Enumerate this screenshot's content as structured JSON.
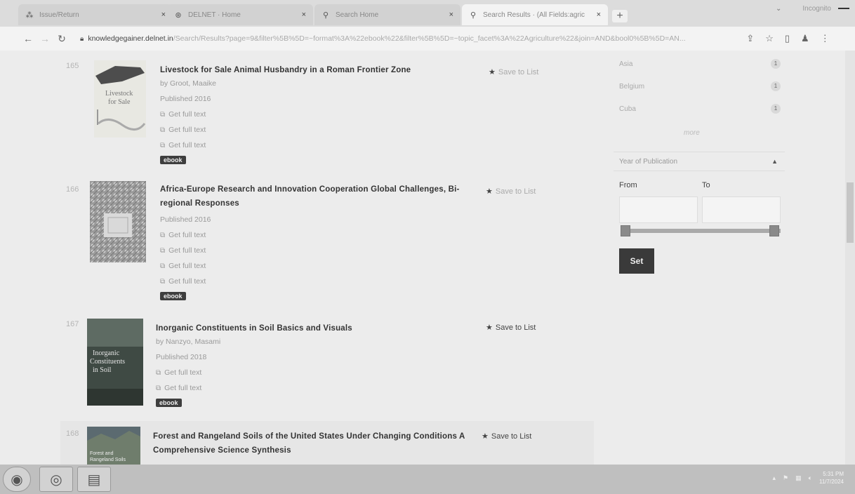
{
  "tabs": [
    {
      "title": "Issue/Return",
      "icon": "network-icon"
    },
    {
      "title": "DELNET · Home",
      "icon": "globe-icon"
    },
    {
      "title": "Search Home",
      "icon": "search-icon"
    },
    {
      "title": "Search Results · (All Fields:agric",
      "icon": "search-icon"
    }
  ],
  "window": {
    "profile_label": "Incognito",
    "profile_badge": ""
  },
  "address": {
    "domain": "knowledgegainer.delnet.in",
    "path": "/Search/Results?page=9&filter%5B%5D=~format%3A%22ebook%22&filter%5B%5D=~topic_facet%3A%22Agriculture%22&join=AND&bool0%5B%5D=AN..."
  },
  "results": [
    {
      "number": "165",
      "title_lines": [
        "Livestock for Sale Animal Husbandry in a Roman Frontier Zone"
      ],
      "author": "by Groot, Maaike",
      "published": "Published 2016",
      "links": [
        "Get full text",
        "Get full text",
        "Get full text"
      ],
      "format": "ebook",
      "save": "Save to List",
      "cover_text": [
        "Livestock",
        "for Sale"
      ]
    },
    {
      "number": "166",
      "title_lines": [
        "Africa-Europe Research and Innovation Cooperation Global Challenges, Bi-",
        "regional Responses"
      ],
      "author": "",
      "published": "Published 2016",
      "links": [
        "Get full text",
        "Get full text",
        "Get full text",
        "Get full text"
      ],
      "format": "ebook",
      "save": "Save to List"
    },
    {
      "number": "167",
      "title_lines": [
        "Inorganic Constituents in Soil Basics and Visuals"
      ],
      "author": "by Nanzyo, Masami",
      "published": "Published 2018",
      "links": [
        "Get full text",
        "Get full text"
      ],
      "format": "ebook",
      "save": "Save to List",
      "cover_text": [
        "Inorganic",
        "Constituents",
        "in Soil"
      ]
    },
    {
      "number": "168",
      "title_lines": [
        "Forest and Rangeland Soils of the United States Under Changing Conditions A",
        "Comprehensive Science Synthesis"
      ],
      "save": "Save to List",
      "cover_text": [
        "Forest and",
        "Rangeland Soils"
      ]
    }
  ],
  "facets": {
    "countries": [
      {
        "name": "Asia",
        "count": "1"
      },
      {
        "name": "Belgium",
        "count": "1"
      },
      {
        "name": "Cuba",
        "count": "1"
      }
    ],
    "more": "more",
    "year_heading": "Year of Publication",
    "from_label": "From",
    "to_label": "To",
    "from_value": "",
    "to_value": "",
    "set_label": "Set"
  },
  "taskbar": {
    "time": "5:31 PM",
    "date": "11/7/2024"
  }
}
